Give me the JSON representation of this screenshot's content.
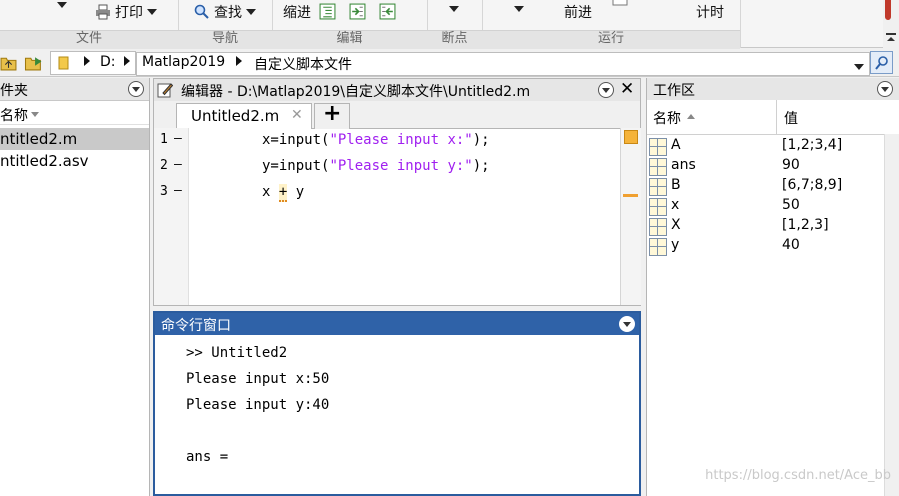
{
  "ribbon": {
    "print_label": "打印",
    "find_label": "查找",
    "indent_label": "缩进",
    "advance_label": "前进",
    "timing_label": "计时",
    "groups": {
      "file": "文件",
      "navigate": "导航",
      "edit": "编辑",
      "breakpoints": "断点",
      "run": "运行"
    }
  },
  "address": {
    "drive": "D:",
    "folder": "Matlap2019",
    "subfolder": "自定义脚本文件"
  },
  "current_folder": {
    "title": "件夹",
    "column_name": "名称",
    "files": [
      {
        "name": "ntitled2.m",
        "selected": true
      },
      {
        "name": "ntitled2.asv",
        "selected": false
      }
    ]
  },
  "editor": {
    "title": "编辑器 - D:\\Matlap2019\\自定义脚本文件\\Untitled2.m",
    "tab_label": "Untitled2.m",
    "add_tab_symbol": "+",
    "lines": [
      {
        "num": "1",
        "marker": "—",
        "code_pre": "x=input(",
        "code_str": "\"Please input x:\"",
        "code_post": ");"
      },
      {
        "num": "2",
        "marker": "—",
        "code_pre": "y=input(",
        "code_str": "\"Please input y:\"",
        "code_post": ");"
      },
      {
        "num": "3",
        "marker": "—",
        "code_pre": "x ",
        "code_op": "+",
        "code_post": " y"
      }
    ]
  },
  "command_window": {
    "title": "命令行窗口",
    "lines": [
      ">> Untitled2",
      "Please input x:50",
      "Please input y:40",
      "",
      "ans ="
    ]
  },
  "workspace": {
    "title": "工作区",
    "col_name": "名称",
    "col_value": "值",
    "vars": [
      {
        "name": "A",
        "value": "[1,2;3,4]"
      },
      {
        "name": "ans",
        "value": "90"
      },
      {
        "name": "B",
        "value": "[6,7;8,9]"
      },
      {
        "name": "x",
        "value": "50"
      },
      {
        "name": "X",
        "value": "[1,2,3]"
      },
      {
        "name": "y",
        "value": "40"
      }
    ]
  },
  "watermark": "https://blog.csdn.net/Ace_bb",
  "colors": {
    "cmd_title_bg": "#2f62a8",
    "string": "#a020f0",
    "selection": "#c9c9c9",
    "warning_marker": "#f0a030"
  }
}
